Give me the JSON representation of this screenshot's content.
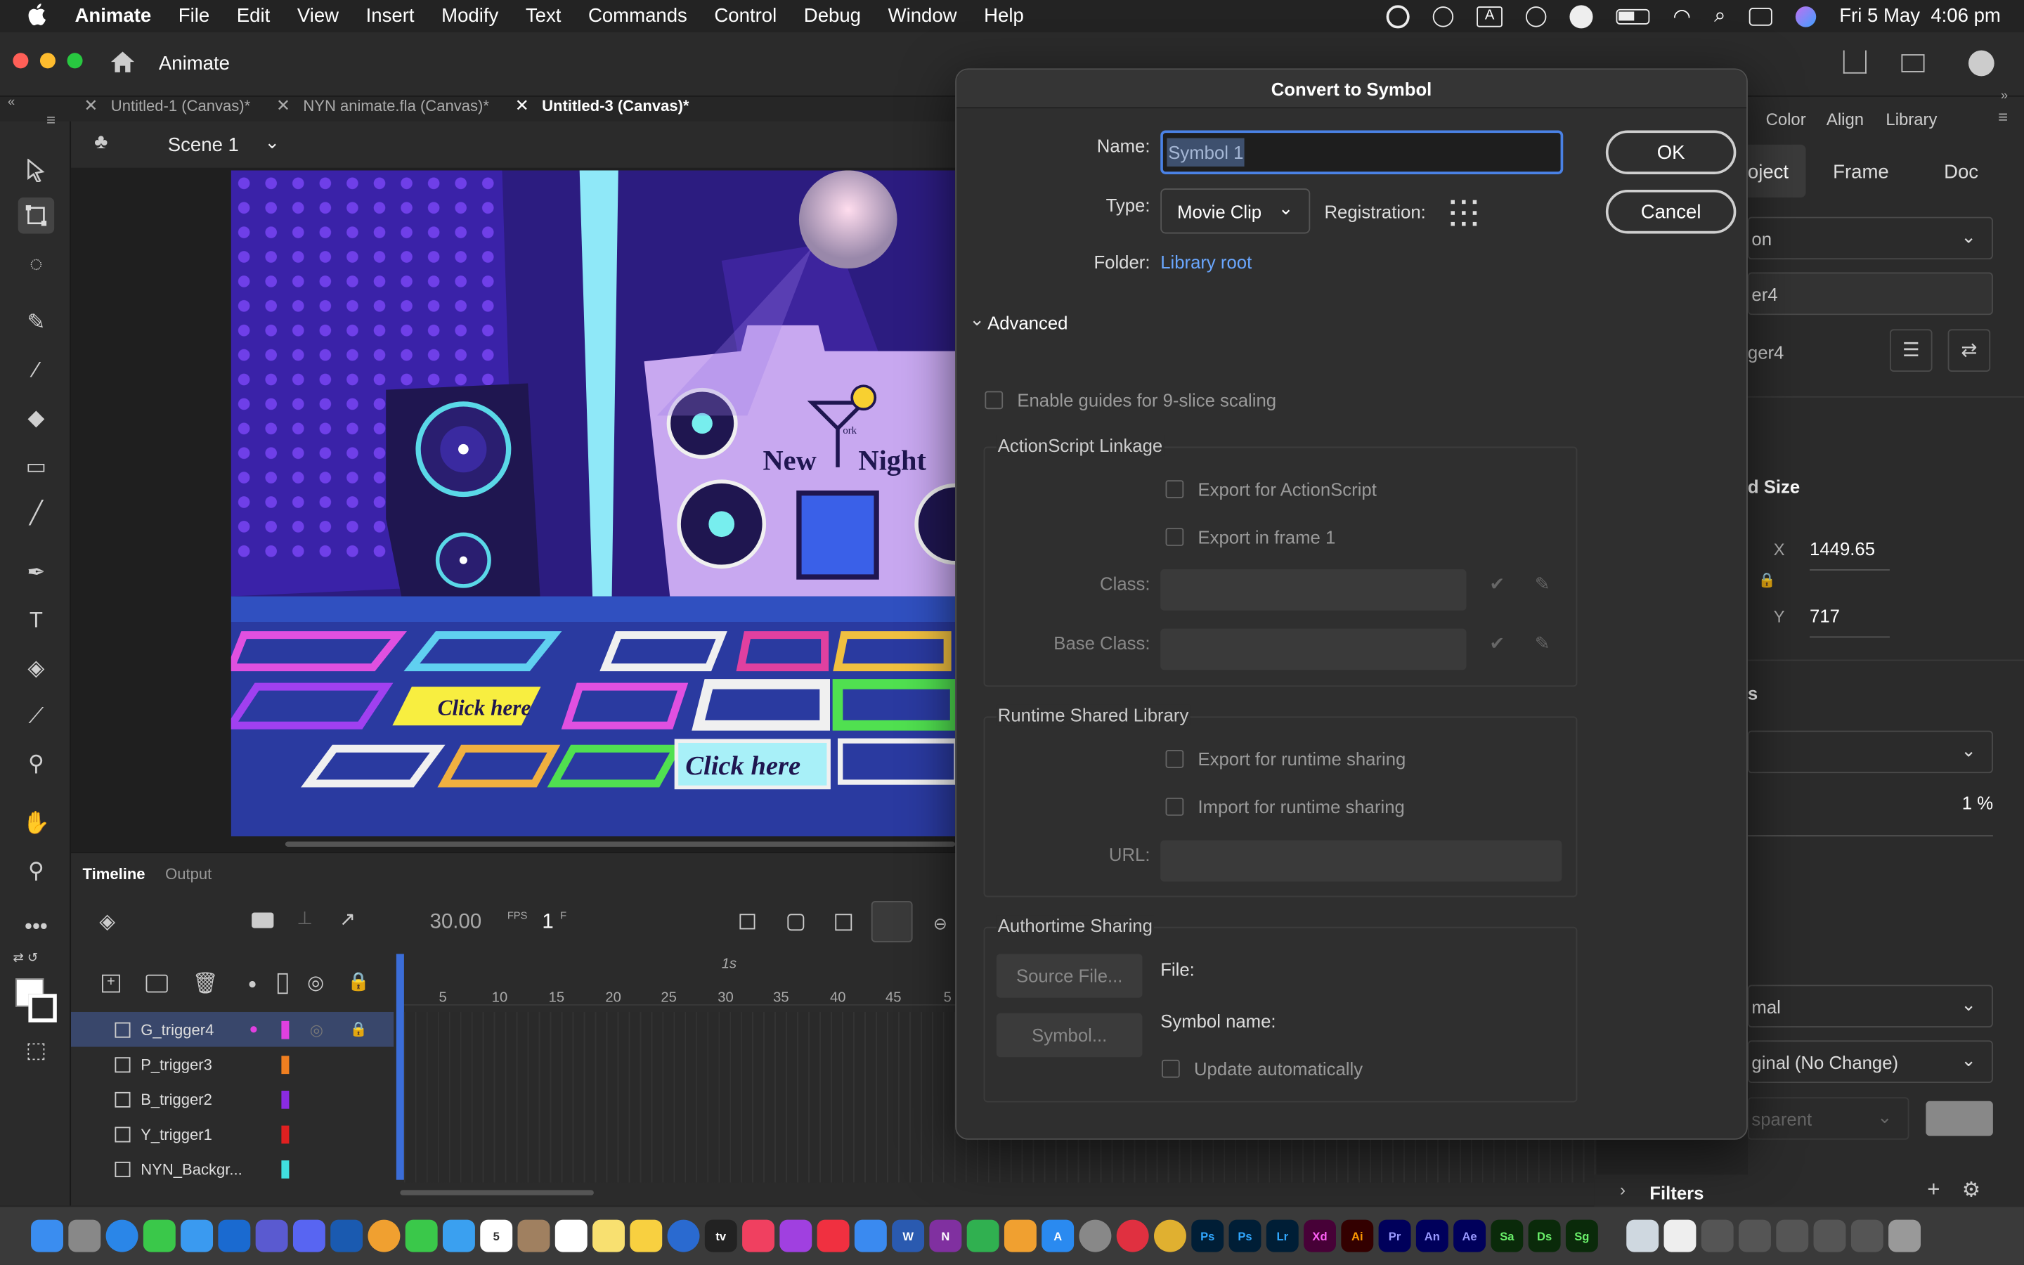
{
  "menubar": {
    "app_name": "Animate",
    "items": [
      "File",
      "Edit",
      "View",
      "Insert",
      "Modify",
      "Text",
      "Commands",
      "Control",
      "Debug",
      "Window",
      "Help"
    ],
    "datetime": "Fri 5 May  4:06 pm"
  },
  "app_header": {
    "title": "Animate"
  },
  "tabs": [
    {
      "label": "Untitled-1 (Canvas)*",
      "active": false
    },
    {
      "label": "NYN animate.fla (Canvas)*",
      "active": false
    },
    {
      "label": "Untitled-3 (Canvas)*",
      "active": true
    }
  ],
  "scene": {
    "label": "Scene 1"
  },
  "stage": {
    "sign_text_1": "New",
    "sign_text_2": "Night",
    "sign_small": "ork",
    "button_1": "Click here",
    "button_2": "Click here"
  },
  "timeline": {
    "tabs": [
      "Timeline",
      "Output"
    ],
    "fps": "30.00",
    "fps_unit": "FPS",
    "frame": "1",
    "frame_unit": "F",
    "second_marker": "1s",
    "ruler": [
      "5",
      "10",
      "15",
      "20",
      "25",
      "30",
      "35",
      "40",
      "45",
      "5"
    ],
    "layers": [
      {
        "name": "G_trigger4",
        "color": "#e040e0",
        "selected": true
      },
      {
        "name": "P_trigger3",
        "color": "#f07f20",
        "selected": false
      },
      {
        "name": "B_trigger2",
        "color": "#8a2be2",
        "selected": false
      },
      {
        "name": "Y_trigger1",
        "color": "#e02020",
        "selected": false
      },
      {
        "name": "NYN_Backgr...",
        "color": "#40e0e0",
        "selected": false
      }
    ]
  },
  "dialog": {
    "title": "Convert to Symbol",
    "name_label": "Name:",
    "name_value": "Symbol 1",
    "type_label": "Type:",
    "type_value": "Movie Clip",
    "registration_label": "Registration:",
    "folder_label": "Folder:",
    "folder_value": "Library root",
    "ok_label": "OK",
    "cancel_label": "Cancel",
    "advanced_label": "Advanced",
    "nine_slice_label": "Enable guides for 9-slice scaling",
    "actionscript": {
      "title": "ActionScript Linkage",
      "export_as": "Export for ActionScript",
      "export_frame1": "Export in frame 1",
      "class_label": "Class:",
      "base_class_label": "Base Class:"
    },
    "runtime": {
      "title": "Runtime Shared Library",
      "export_runtime": "Export for runtime sharing",
      "import_runtime": "Import for runtime sharing",
      "url_label": "URL:"
    },
    "authortime": {
      "title": "Authortime Sharing",
      "source_file_btn": "Source File...",
      "symbol_btn": "Symbol...",
      "file_label": "File:",
      "symbol_name_label": "Symbol name:",
      "update_auto": "Update automatically"
    }
  },
  "right_panel": {
    "top_tabs": [
      "Color",
      "Align",
      "Library"
    ],
    "tabs": [
      "oject",
      "Frame",
      "Doc"
    ],
    "dropdown1": "on",
    "instance_field": "er4",
    "instance_label": "ger4",
    "section_size": "d Size",
    "x_label": "X",
    "x_value": "1449.65",
    "y_label": "Y",
    "y_value": "717",
    "section_s": "s",
    "percent": "1 %",
    "blend": "mal",
    "render": "ginal (No Change)",
    "transparent": "sparent",
    "filters_label": "Filters"
  }
}
